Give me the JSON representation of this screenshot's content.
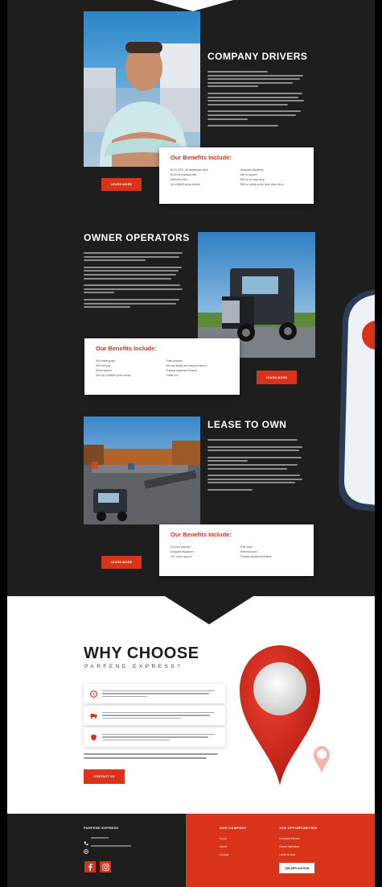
{
  "company_drivers": {
    "title": "COMPANY DRIVERS",
    "benefits_heading": "Our Benefits Include:",
    "benefits_col1": [
      "$0.70 CPM - all dispatched miles",
      "$0.65 for practical mile",
      "Referral bonus",
      "Up to $8600 gross weekly"
    ],
    "benefits_col2": [
      "Assigned dispatcher",
      "$50 for layover",
      "$50 for an extra drop",
      "$50 for rolling up the tarps (step deck)"
    ],
    "button": "LEARN MORE"
  },
  "owner_operators": {
    "title": "OWNER OPERATORS",
    "benefits_heading": "Our Benefits Include:",
    "benefits_col1": [
      "90% starting pay",
      "90% fuel pay",
      "Direct deposit",
      "Earn up to $8600 gross weekly"
    ],
    "benefits_col2": [
      "Plate program",
      "We pay liability and cargo insurance",
      "Prepass equipment finance",
      "Trailer rent"
    ],
    "button": "LEARN MORE"
  },
  "lease_to_own": {
    "title": "LEASE TO OWN",
    "benefits_heading": "Our Benefits Include:",
    "benefits_col1": [
      "$0 down payment",
      "Assigned dispatcher",
      "24/7 driver support"
    ],
    "benefits_col2": [
      "Fuel cards",
      "Referral bonus",
      "Prepass equipment finance"
    ],
    "button": "LEARN MORE"
  },
  "why_choose": {
    "title": "WHY CHOOSE",
    "subtitle": "PARFENE EXPRESS?",
    "button": "CONTACT US"
  },
  "footer": {
    "brand": "PARFENE EXPRESS",
    "our_company_heading": "OUR COMPANY",
    "our_company_links": [
      "Home",
      "About",
      "Contact"
    ],
    "job_heading": "JOB OPPORTUNITIES",
    "job_links": [
      "Company Drivers",
      "Owner Operators",
      "Lease to Own"
    ],
    "job_button": "JOB APPLICATION",
    "social_icons": [
      "facebook-icon",
      "instagram-icon"
    ]
  },
  "colors": {
    "accent": "#d9331a",
    "dark": "#1e1e1e"
  }
}
